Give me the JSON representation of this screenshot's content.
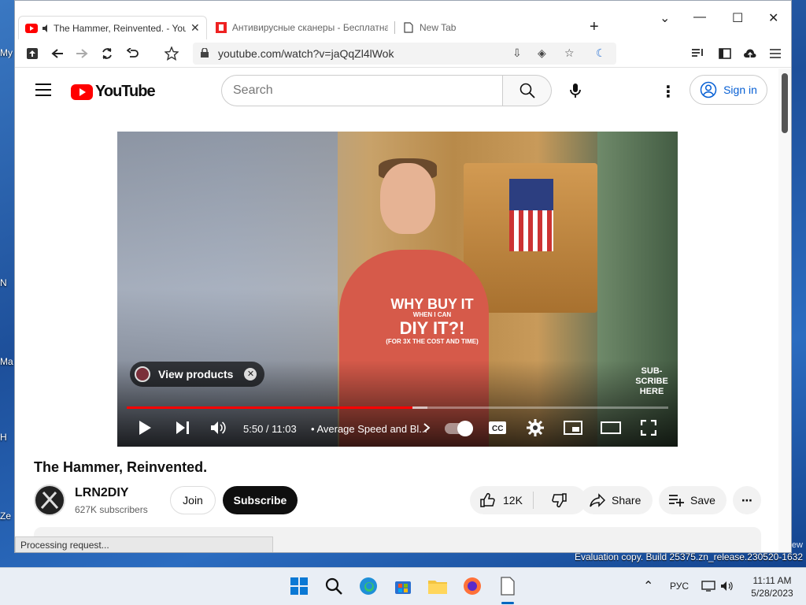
{
  "desktop": {
    "labels": [
      "My",
      "N",
      "Ma",
      "H",
      "Ze"
    ],
    "evaluation_top": "iew",
    "evaluation_text": "Evaluation copy. Build 25375.zn_release.230520-1632"
  },
  "browser": {
    "tabs": [
      {
        "title": "The Hammer, Reinvented. - You",
        "favicon": "youtube-icon",
        "audio": "speaker-icon"
      },
      {
        "title": "Антивирусные сканеры - Бесплатная",
        "favicon": "red-logo-icon"
      },
      {
        "title": "New Tab",
        "favicon": "page-icon"
      }
    ],
    "new_tab": "+",
    "window_controls": {
      "dropdown": "⌄",
      "minimize": "—",
      "maximize": "☐",
      "close": "✕"
    },
    "url": "youtube.com/watch?v=jaQqZl4lWok",
    "status_text": "Processing request..."
  },
  "youtube": {
    "logo_text": "YouTube",
    "search_placeholder": "Search",
    "signin_label": "Sign in",
    "player": {
      "shirt_line1": "WHY BUY IT",
      "shirt_line2": "WHEN I CAN",
      "shirt_line3": "DIY IT?!",
      "shirt_line4": "(FOR 3X THE COST AND TIME)",
      "view_products": "View products",
      "subscribe_here": "SUB-\nSCRIBE\nHERE",
      "time": "5:50 / 11:03",
      "chapter": "• Average Speed and Bl...",
      "progress_played": 0.527,
      "progress_loaded": 0.555
    },
    "video_title": "The Hammer, Reinvented.",
    "channel_name": "LRN2DIY",
    "channel_subs": "627K subscribers",
    "join_label": "Join",
    "subscribe_label": "Subscribe",
    "like_count": "12K",
    "share_label": "Share",
    "save_label": "Save"
  },
  "taskbar": {
    "language": "РУС",
    "time": "11:11 AM",
    "date": "5/28/2023"
  }
}
